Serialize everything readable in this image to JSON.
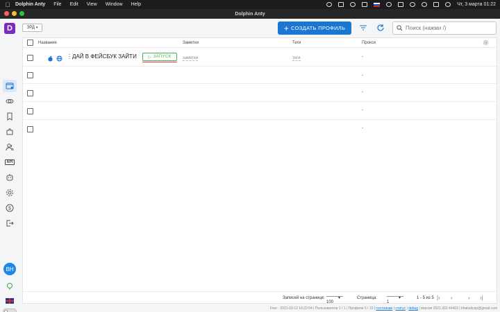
{
  "menubar": {
    "app_name": "Dolphin Anty",
    "items": [
      "File",
      "Edit",
      "View",
      "Window",
      "Help"
    ],
    "clock": "Чт, 3 марта  01:22"
  },
  "window": {
    "title": "Dolphin Anty"
  },
  "sidebar": {
    "logo": "D",
    "items": [
      {
        "name": "browser-profiles",
        "icon": "browser-icon",
        "active": true
      },
      {
        "name": "proxies",
        "icon": "link-icon"
      },
      {
        "name": "bookmarks",
        "icon": "bookmark-icon"
      },
      {
        "name": "extensions",
        "icon": "puzzle-icon"
      },
      {
        "name": "team",
        "icon": "users-icon"
      },
      {
        "name": "api",
        "icon": "api-icon",
        "label": "API"
      },
      {
        "name": "automation",
        "icon": "robot-icon"
      },
      {
        "name": "settings",
        "icon": "gear-icon"
      },
      {
        "name": "billing",
        "icon": "dollar-icon"
      },
      {
        "name": "logout",
        "icon": "logout-icon"
      }
    ],
    "avatar": "BH"
  },
  "toolbar": {
    "folder_select": "ЗРД",
    "create_button": "СОЗДАТЬ ПРОФИЛЬ",
    "search_placeholder": "Поиск (нажми /)"
  },
  "table": {
    "headers": {
      "name": "Название",
      "notes": "Заметки",
      "tags": "Теги",
      "proxy": "Прокси"
    },
    "rows": [
      {
        "name": "ДАЙ В ФЕЙСБУК ЗАЙТИ",
        "launch": "ЗАПУСК",
        "notes": "заметки",
        "tags": "теги",
        "proxy": "-"
      },
      {
        "proxy": "-"
      },
      {
        "proxy": "-"
      },
      {
        "proxy": "-"
      },
      {
        "proxy": "-"
      }
    ]
  },
  "pagination": {
    "per_page_label": "Записей на странице:",
    "per_page_value": "100",
    "page_label": "Страница:",
    "page_value": "1",
    "range": "1 - 5 из 5"
  },
  "status": {
    "plan": "Free · 2021-03-12 16:22:04",
    "users": "Пользователи 1 / 1",
    "profiles": "Профили 5 / 10",
    "link1": "состояние",
    "link2": "статус",
    "link3": "debug",
    "version": "версия 2021.302.44402",
    "email": "bhalodiyap@gmail.com"
  },
  "colors": {
    "accent": "#1976d2",
    "launch": "#4caf50",
    "logo": "#7b2cbf"
  }
}
